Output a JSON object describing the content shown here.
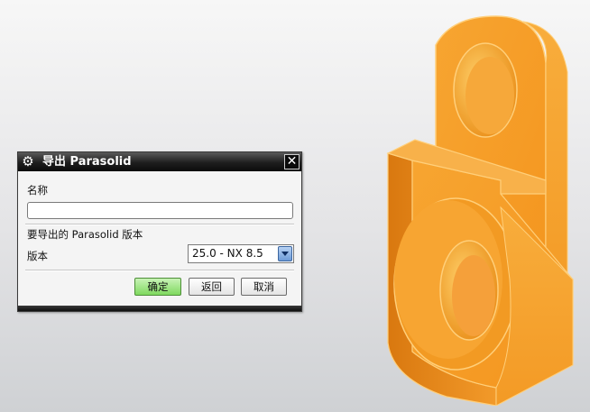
{
  "dialog": {
    "title": "导出 Parasolid",
    "name_label": "名称",
    "name_value": "",
    "section_label": "要导出的 Parasolid 版本",
    "version_label": "版本",
    "version_value": "25.0 - NX 8.5",
    "ok_label": "确定",
    "back_label": "返回",
    "cancel_label": "取消",
    "close_glyph": "✕",
    "gear_glyph": "⚙"
  },
  "colors": {
    "part_orange": "#f5a623",
    "part_edge": "#f7c36a",
    "ok_green": "#8fdd6f",
    "titlebar": "#111111"
  }
}
